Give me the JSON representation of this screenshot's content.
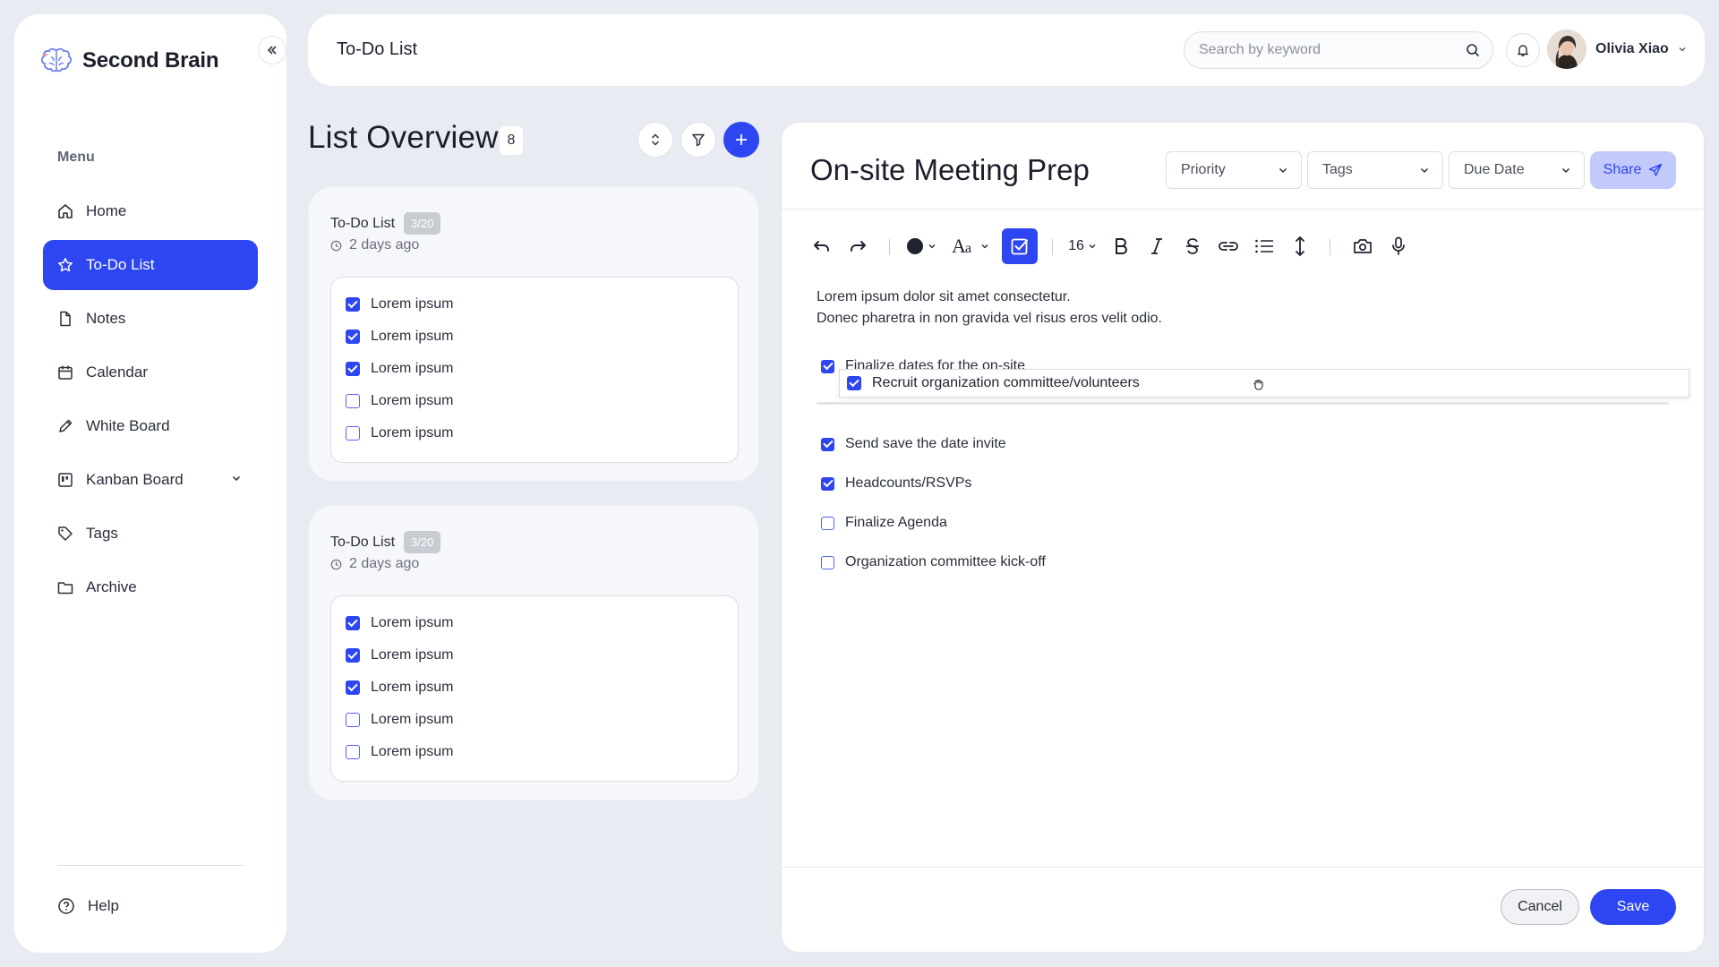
{
  "app": {
    "name": "Second Brain"
  },
  "sidebar": {
    "menu_title": "Menu",
    "items": [
      {
        "label": "Home",
        "icon": "home-icon"
      },
      {
        "label": "To-Do List",
        "icon": "star-icon",
        "active": true
      },
      {
        "label": "Notes",
        "icon": "file-icon"
      },
      {
        "label": "Calendar",
        "icon": "calendar-icon"
      },
      {
        "label": "White Board",
        "icon": "pencil-icon"
      },
      {
        "label": "Kanban Board",
        "icon": "kanban-icon",
        "expandable": true
      },
      {
        "label": "Tags",
        "icon": "tag-icon"
      },
      {
        "label": "Archive",
        "icon": "folder-icon"
      }
    ],
    "help_label": "Help"
  },
  "header": {
    "title": "To-Do List",
    "search_placeholder": "Search by keyword",
    "user_name": "Olivia Xiao"
  },
  "overview": {
    "title": "List Overview",
    "count": "8",
    "cards": [
      {
        "title": "To-Do List",
        "progress": "3/20",
        "time": "2 days ago",
        "items": [
          {
            "label": "Lorem ipsum",
            "checked": true
          },
          {
            "label": "Lorem ipsum",
            "checked": true
          },
          {
            "label": "Lorem ipsum",
            "checked": true
          },
          {
            "label": "Lorem ipsum",
            "checked": false
          },
          {
            "label": "Lorem ipsum",
            "checked": false
          }
        ]
      },
      {
        "title": "To-Do List",
        "progress": "3/20",
        "time": "2 days ago",
        "items": [
          {
            "label": "Lorem ipsum",
            "checked": true
          },
          {
            "label": "Lorem ipsum",
            "checked": true
          },
          {
            "label": "Lorem ipsum",
            "checked": true
          },
          {
            "label": "Lorem ipsum",
            "checked": false
          },
          {
            "label": "Lorem ipsum",
            "checked": false
          }
        ]
      }
    ]
  },
  "editor": {
    "title": "On-site Meeting Prep",
    "priority_label": "Priority",
    "tags_label": "Tags",
    "due_date_label": "Due Date",
    "share_label": "Share",
    "font_size": "16",
    "paragraph_lines": [
      "Lorem ipsum dolor sit amet consectetur.",
      "Donec pharetra in non gravida vel risus eros velit odio."
    ],
    "tasks": [
      {
        "label": "Finalize dates for the on-site",
        "checked": true
      },
      {
        "label": "Send save the date invite",
        "checked": true
      },
      {
        "label": "Headcounts/RSVPs",
        "checked": true
      },
      {
        "label": "Finalize Agenda",
        "checked": false
      },
      {
        "label": "Organization committee kick-off",
        "checked": false
      }
    ],
    "dragged_task": {
      "label": "Recruit organization committee/volunteers",
      "checked": true
    },
    "cancel_label": "Cancel",
    "save_label": "Save"
  },
  "colors": {
    "accent": "#2e46f2",
    "background": "#e9ebf2",
    "share_bg": "#c2c9fb"
  }
}
